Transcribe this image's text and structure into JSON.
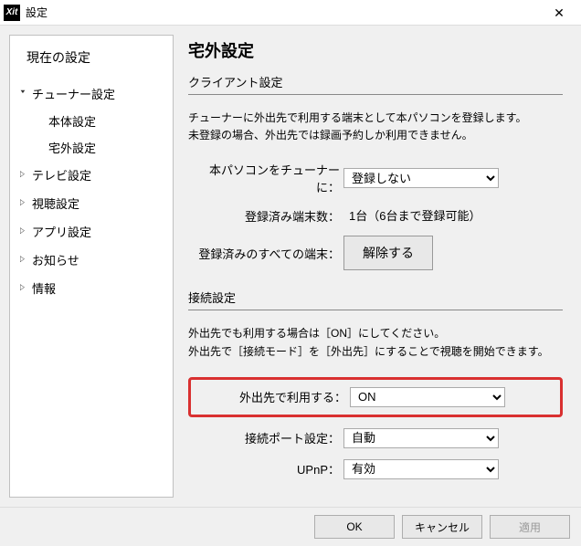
{
  "titlebar": {
    "app_icon_text": "Xit",
    "title": "設定"
  },
  "sidebar": {
    "heading": "現在の設定",
    "items": [
      {
        "label": "チューナー設定",
        "expanded": true,
        "children": [
          {
            "label": "本体設定"
          },
          {
            "label": "宅外設定"
          }
        ]
      },
      {
        "label": "テレビ設定"
      },
      {
        "label": "視聴設定"
      },
      {
        "label": "アプリ設定"
      },
      {
        "label": "お知らせ"
      },
      {
        "label": "情報"
      }
    ]
  },
  "main": {
    "page_title": "宅外設定",
    "client_section": {
      "heading": "クライアント設定",
      "desc_line1": "チューナーに外出先で利用する端末として本パソコンを登録します。",
      "desc_line2": "未登録の場合、外出先では録画予約しか利用できません。",
      "register_label": "本パソコンをチューナーに：",
      "register_value": "登録しない",
      "registered_count_label": "登録済み端末数：",
      "registered_count_value": "1台（6台まで登録可能）",
      "release_all_label": "登録済みのすべての端末：",
      "release_button": "解除する"
    },
    "connection_section": {
      "heading": "接続設定",
      "desc_line1": "外出先でも利用する場合は［ON］にしてください。",
      "desc_line2": "外出先で［接続モード］を［外出先］にすることで視聴を開始できます。",
      "use_remote_label": "外出先で利用する：",
      "use_remote_value": "ON",
      "port_label": "接続ポート設定：",
      "port_value": "自動",
      "upnp_label": "UPnP：",
      "upnp_value": "有効"
    }
  },
  "footer": {
    "ok": "OK",
    "cancel": "キャンセル",
    "apply": "適用"
  }
}
